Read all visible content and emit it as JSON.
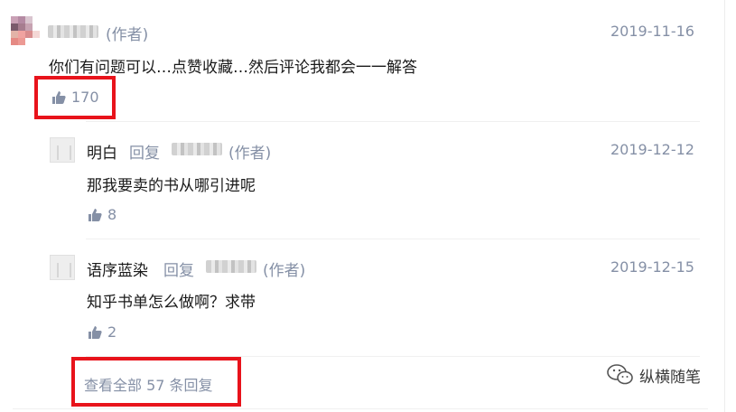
{
  "comments": {
    "main": {
      "role_tag": "(作者)",
      "date": "2019-11-16",
      "content": "你们有问题可以…点赞收藏…然后评论我都会一一解答",
      "likes": "170"
    },
    "replies": [
      {
        "author": "明白",
        "reply_word": "回复",
        "role_tag": "(作者)",
        "date": "2019-12-12",
        "content": "那我要卖的书从哪引进呢",
        "likes": "8"
      },
      {
        "author": "语序蓝染",
        "reply_word": "回复",
        "role_tag": "(作者)",
        "date": "2019-12-15",
        "content": "知乎书单怎么做啊？求带",
        "likes": "2"
      }
    ],
    "view_all_label": "查看全部 57 条回复"
  },
  "watermark": {
    "text": "纵横随笔",
    "icon": "wechat-icon"
  },
  "colors": {
    "highlight": "#e8131b",
    "meta": "#8590a6",
    "text": "#1a1a1a"
  }
}
